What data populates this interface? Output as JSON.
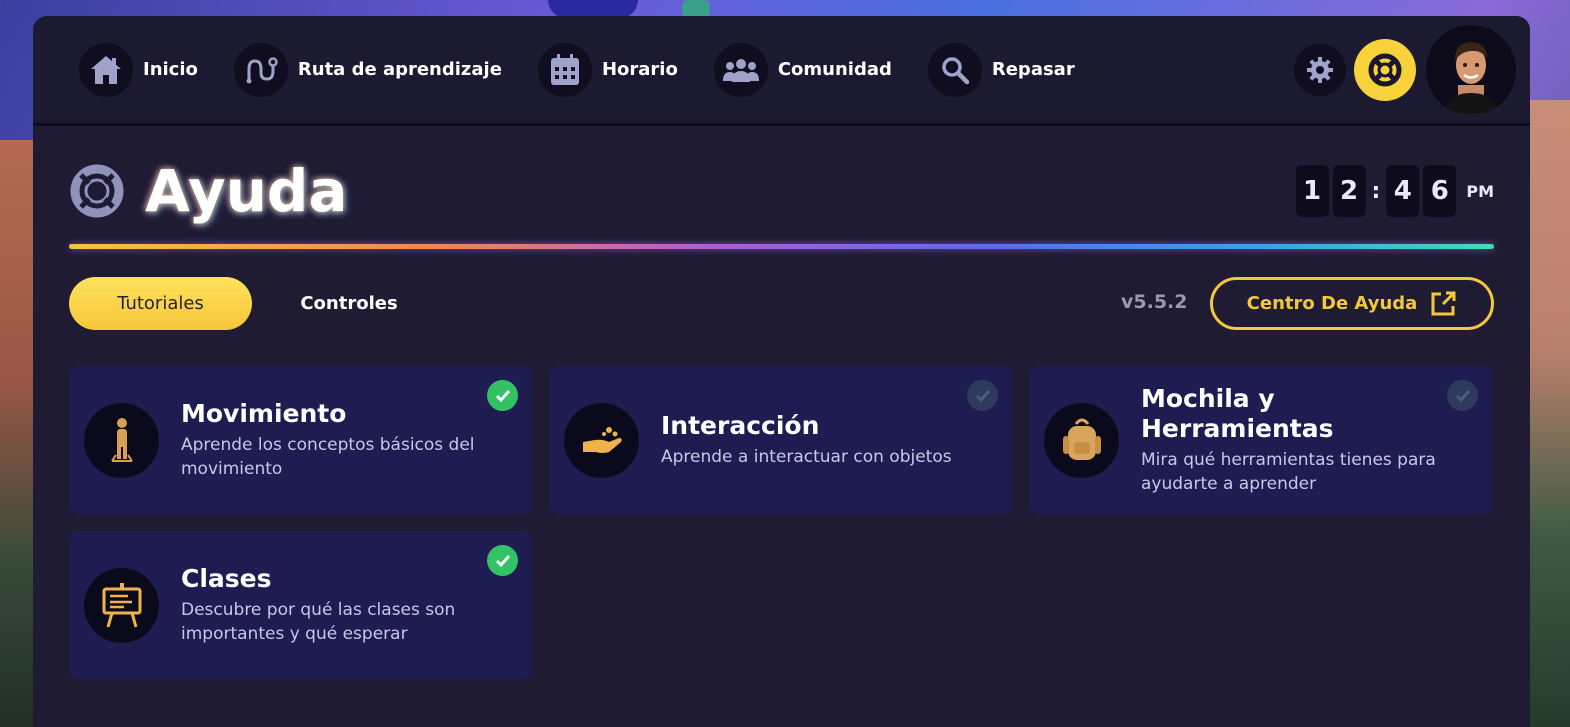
{
  "nav": {
    "items": [
      {
        "label": "Inicio",
        "icon": "home-icon"
      },
      {
        "label": "Ruta de aprendizaje",
        "icon": "route-icon"
      },
      {
        "label": "Horario",
        "icon": "calendar-icon"
      },
      {
        "label": "Comunidad",
        "icon": "people-icon"
      },
      {
        "label": "Repasar",
        "icon": "search-icon"
      }
    ],
    "settings_icon": "gear-icon",
    "help_icon": "lifebuoy-icon",
    "help_color": "#f7d23a"
  },
  "page": {
    "title": "Ayuda",
    "title_icon": "lifebuoy-icon"
  },
  "clock": {
    "h1": "1",
    "h2": "2",
    "sep": ":",
    "m1": "4",
    "m2": "6",
    "ampm": "PM"
  },
  "tabs": {
    "active": "Tutoriales",
    "inactive": "Controles"
  },
  "version": "v5.5.2",
  "help_center": {
    "label": "Centro De Ayuda",
    "icon": "external-link-icon",
    "color": "#f5c73a"
  },
  "tutorials": [
    {
      "title": "Movimiento",
      "desc": "Aprende los conceptos básicos del movimiento",
      "icon": "person-walking-icon",
      "completed": true
    },
    {
      "title": "Interacción",
      "desc": "Aprende a interactuar con objetos",
      "icon": "hand-icon",
      "completed": false
    },
    {
      "title": "Mochila y Herramientas",
      "desc": "Mira qué herramientas tienes para ayudarte a aprender",
      "icon": "backpack-icon",
      "completed": false
    },
    {
      "title": "Clases",
      "desc": "Descubre por qué las clases son importantes y qué esperar",
      "icon": "easel-icon",
      "completed": true
    }
  ],
  "colors": {
    "panel": "#1e1b33",
    "card": "#1f1c52",
    "accent": "#f5c73a",
    "check_done": "#33c263"
  }
}
